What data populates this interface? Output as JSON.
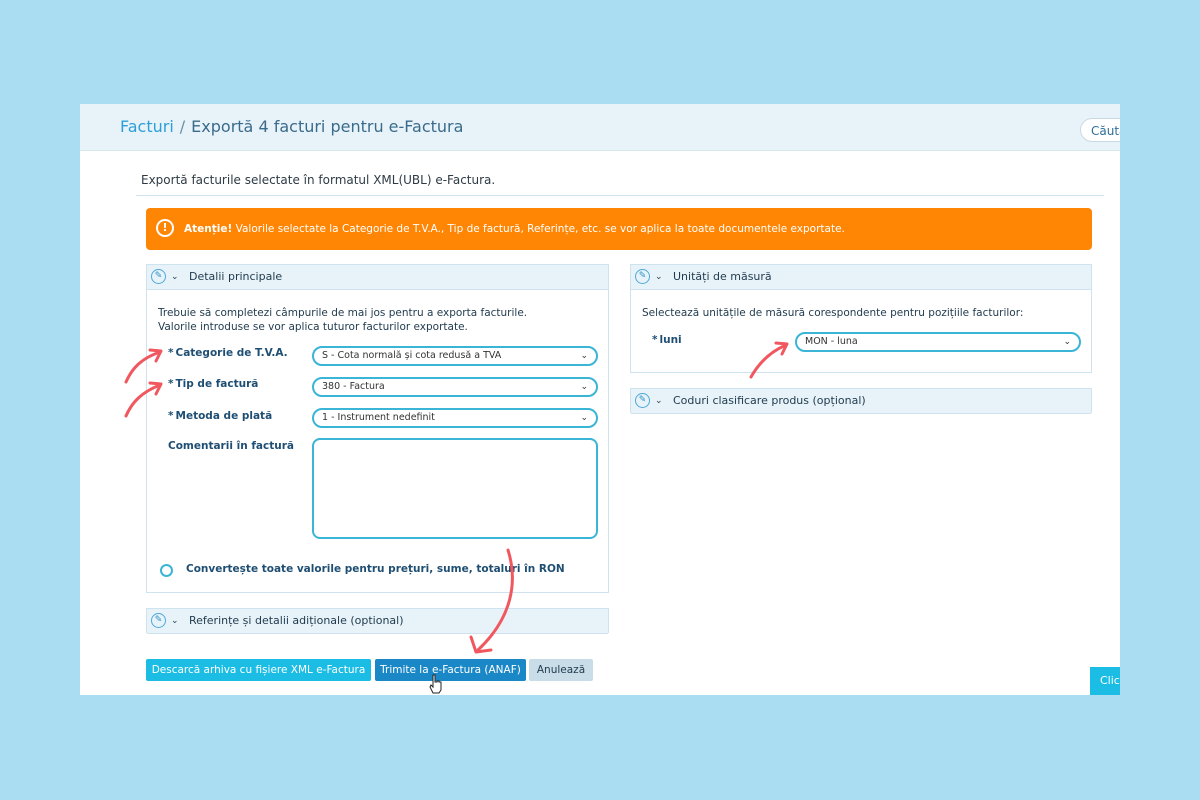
{
  "breadcrumb": {
    "root": "Facturi",
    "separator": "/",
    "current": "Exportă 4 facturi pentru e-Factura"
  },
  "search": {
    "label": "Căuta"
  },
  "subtitle": "Exportă facturile selectate în formatul XML(UBL) e-Factura.",
  "alert": {
    "strong": "Atenție!",
    "text": " Valorile selectate la Categorie de T.V.A., Tip de factură, Referințe, etc. se vor aplica la toate documentele exportate.",
    "icon": "exclamation-icon",
    "color": "#ff8605"
  },
  "details_panel": {
    "title": "Detalii principale",
    "intro_line1": "Trebuie să completezi câmpurile de mai jos pentru a exporta facturile.",
    "intro_line2": "Valorile introduse se vor aplica tuturor facturilor exportate.",
    "fields": {
      "vat_category": {
        "label": "Categorie de T.V.A.",
        "value": "S - Cota normală și cota redusă a TVA"
      },
      "invoice_type": {
        "label": "Tip de factură",
        "value": "380 - Factura"
      },
      "payment_method": {
        "label": "Metoda de plată",
        "value": "1 - Instrument nedefinit"
      },
      "comments": {
        "label": "Comentarii în factură",
        "value": ""
      }
    },
    "required_mark": "*",
    "convert_label": "Convertește toate valorile pentru prețuri, sume, totaluri în RON"
  },
  "references_panel": {
    "title": "Referințe și detalii adiționale (optional)"
  },
  "units_panel": {
    "title": "Unități de măsură",
    "intro": "Selectează unitățile de măsură corespondente pentru pozițiile facturilor:",
    "field_label": "luni",
    "field_value": "MON - luna"
  },
  "codes_panel": {
    "title": "Coduri clasificare produs (opțional)"
  },
  "buttons": {
    "download": "Descarcă arhiva cu fișiere XML e-Factura",
    "send": "Trimite la e-Factura (ANAF)",
    "cancel": "Anulează",
    "clic": "Clic"
  },
  "colors": {
    "background": "#aadcf2",
    "accent": "#1bbde4",
    "annotation": "#f0575f"
  }
}
